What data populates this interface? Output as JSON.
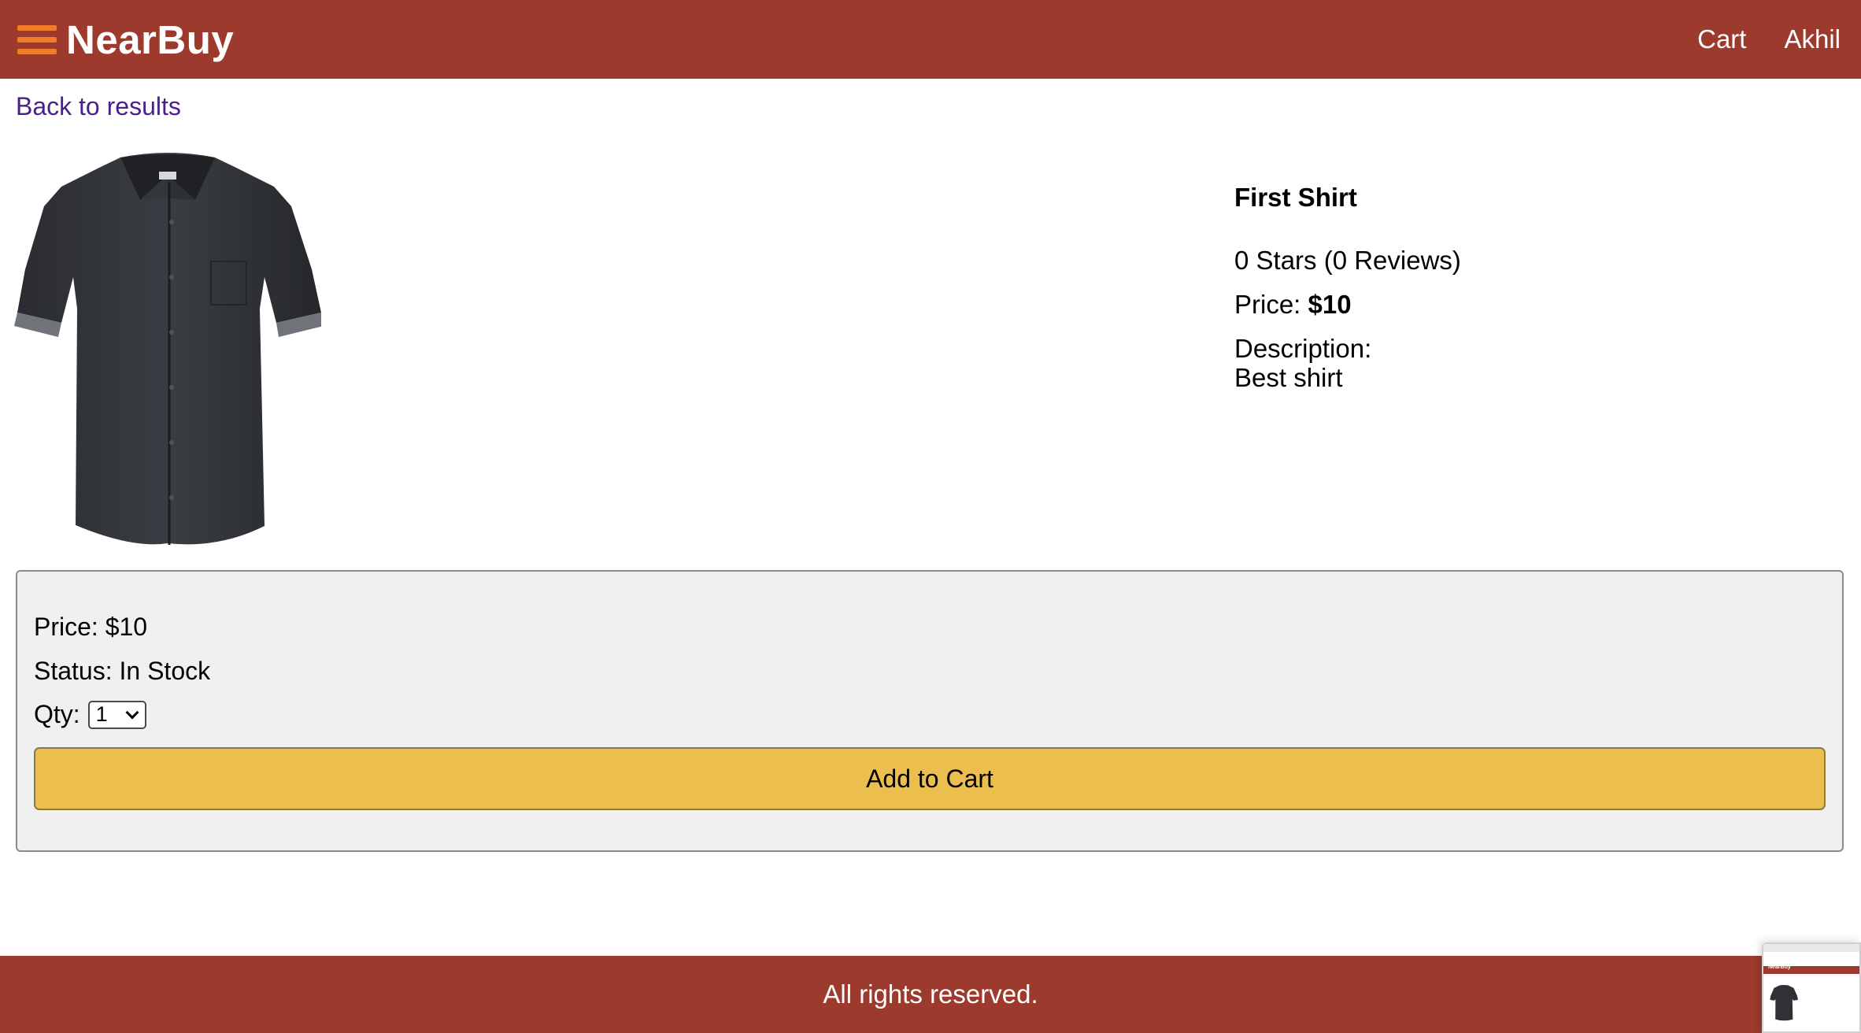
{
  "header": {
    "logo": "NearBuy",
    "nav": {
      "cart": "Cart",
      "user": "Akhil"
    }
  },
  "back_link": "Back to results",
  "product": {
    "image_icon": "shirt-image",
    "name": "First Shirt",
    "rating_text": "0 Stars (0 Reviews)",
    "price_label": "Price: ",
    "price_value": "$10",
    "description_label": "Description:",
    "description": "Best shirt"
  },
  "purchase": {
    "price": "Price: $10",
    "status": "Status: In Stock",
    "qty_label": "Qty:",
    "qty_value": "1",
    "add_to_cart": "Add to Cart"
  },
  "footer": {
    "text": "All rights reserved."
  },
  "thumbnail": {
    "brand": "NearBuy"
  },
  "colors": {
    "header_bg": "#9b3a2d",
    "menu_icon": "#f07c2a",
    "button_bg": "#ecbe4e",
    "card_bg": "#f0f0f0",
    "link": "#4a1f8a"
  }
}
